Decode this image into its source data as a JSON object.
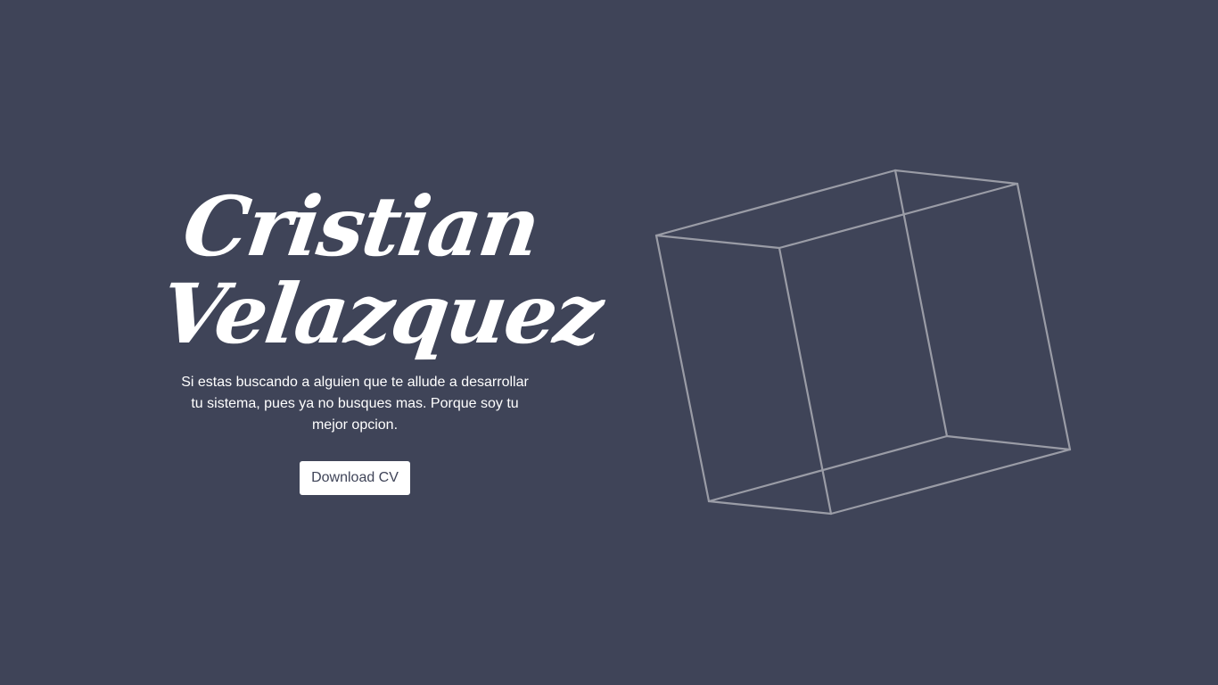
{
  "hero": {
    "name_line1": "Cristian",
    "name_line2": "Velazquez",
    "description": "Si estas buscando a alguien que te allude a desarrollar tu sistema, pues ya no busques mas. Porque soy tu mejor opcion.",
    "download_label": "Download CV"
  },
  "colors": {
    "background": "#3f4458",
    "text": "#ffffff",
    "button_background": "#ffffff",
    "button_text": "#3f4458",
    "cube_stroke": "#9a9ca6"
  },
  "decoration": {
    "cube_icon": "wireframe-cube-icon"
  }
}
